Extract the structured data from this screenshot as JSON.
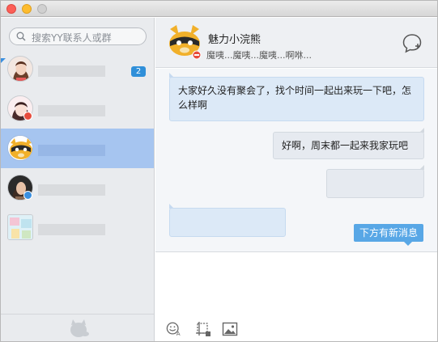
{
  "window": {
    "title": ""
  },
  "search": {
    "placeholder": "搜索YY联系人或群"
  },
  "contacts": [
    {
      "name": "",
      "unread": "2",
      "status": "",
      "active": false
    },
    {
      "name": "",
      "unread": "",
      "status": "busy",
      "active": false
    },
    {
      "name": "",
      "unread": "",
      "status": "",
      "active": true
    },
    {
      "name": "",
      "unread": "",
      "status": "mobile",
      "active": false
    },
    {
      "name": "",
      "unread": "",
      "status": "",
      "active": false
    }
  ],
  "chat": {
    "name": "魅力小浣熊",
    "signature": "魔咦...魔咦...魔咦...啊咻..."
  },
  "messages": [
    {
      "side": "left",
      "text": "大家好久没有聚会了，找个时间一起出来玩一下吧，怎么样啊"
    },
    {
      "side": "right",
      "text": "好啊，周末都一起来我家玩吧"
    },
    {
      "side": "right",
      "text": ""
    },
    {
      "side": "left",
      "text": ""
    }
  ],
  "new_message_tip": "下方有新消息",
  "icons": {
    "search": "search-icon",
    "add_chat": "add-chat-icon",
    "emoji": "emoji-icon",
    "screenshot": "screenshot-icon",
    "image": "image-icon",
    "logo": "yy-logo-icon"
  },
  "colors": {
    "accent": "#3a8fe0",
    "selected_row": "#a6c5f0",
    "bubble_left": "#dce9f7",
    "new_msg_tip": "#58a7e6"
  }
}
